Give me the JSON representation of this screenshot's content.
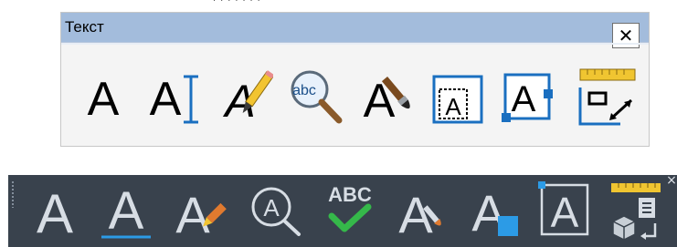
{
  "light_toolbar": {
    "title": "Текст",
    "close_label": "✕",
    "icons": [
      {
        "name": "text-single-line-icon",
        "glyph": "A"
      },
      {
        "name": "text-multiline-icon",
        "glyph": "A"
      },
      {
        "name": "text-edit-icon",
        "glyph": "A"
      },
      {
        "name": "spell-check-icon",
        "glyph": "abc"
      },
      {
        "name": "text-style-icon",
        "glyph": "A"
      },
      {
        "name": "text-frame-icon",
        "glyph": "A"
      },
      {
        "name": "text-scale-icon",
        "glyph": "A"
      },
      {
        "name": "text-justify-icon",
        "glyph": ""
      }
    ]
  },
  "dark_toolbar": {
    "close_label": "×",
    "spell_label": "ABC",
    "icons": [
      {
        "name": "text-single-line-icon",
        "glyph": "A"
      },
      {
        "name": "text-multiline-icon",
        "glyph": "A"
      },
      {
        "name": "text-edit-icon",
        "glyph": "A"
      },
      {
        "name": "text-find-icon",
        "glyph": "A"
      },
      {
        "name": "spell-check-icon",
        "glyph": "ABC"
      },
      {
        "name": "text-style-icon",
        "glyph": "A"
      },
      {
        "name": "text-scale-icon",
        "glyph": "A"
      },
      {
        "name": "text-frame-icon",
        "glyph": "A"
      },
      {
        "name": "text-justify-icon",
        "glyph": ""
      }
    ]
  },
  "colors": {
    "light_title_bar": "#a3bcdc",
    "light_blue_accent": "#1a6fc0",
    "dark_bg": "#39424d",
    "dark_glyph": "#d7dde4",
    "dark_blue_accent": "#2c9be6",
    "green_check": "#35b84a",
    "orange_pencil": "#e07a2f"
  }
}
